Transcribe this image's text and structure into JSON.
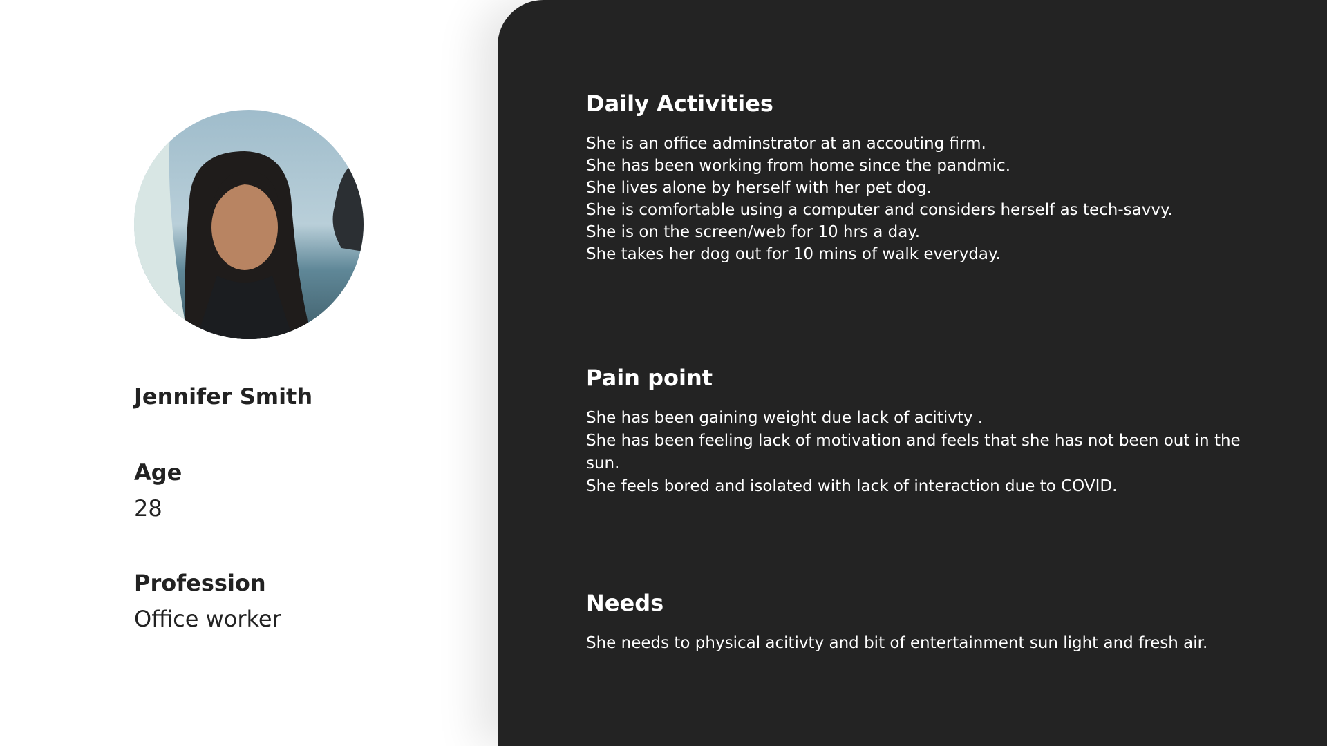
{
  "profile": {
    "name": "Jennifer Smith",
    "age_label": "Age",
    "age_value": "28",
    "profession_label": "Profession",
    "profession_value": "Office worker",
    "avatar_icon": "profile-photo"
  },
  "sections": {
    "daily": {
      "title": "Daily Activities",
      "lines": [
        "She is an office adminstrator at an accouting firm.",
        "She has been working from home since the pandmic.",
        "She lives alone by herself with her pet dog.",
        "She is comfortable using a computer and considers herself as tech-savvy.",
        "She is on the screen/web for 10 hrs a day.",
        "She takes her dog out for 10 mins of walk everyday."
      ]
    },
    "pain": {
      "title": "Pain point",
      "lines": [
        "She has been gaining weight due lack of acitivty .",
        "She has been feeling lack of motivation and feels that she has not  been out in the sun.",
        "She feels bored and isolated with lack of interaction due to  COVID."
      ]
    },
    "needs": {
      "title": "Needs",
      "lines": [
        "She needs to physical acitivty and bit of entertainment sun light and fresh air."
      ]
    }
  },
  "colors": {
    "panel_bg": "#232323",
    "page_bg": "#ffffff",
    "text_dark": "#222222",
    "text_light": "#ffffff"
  }
}
